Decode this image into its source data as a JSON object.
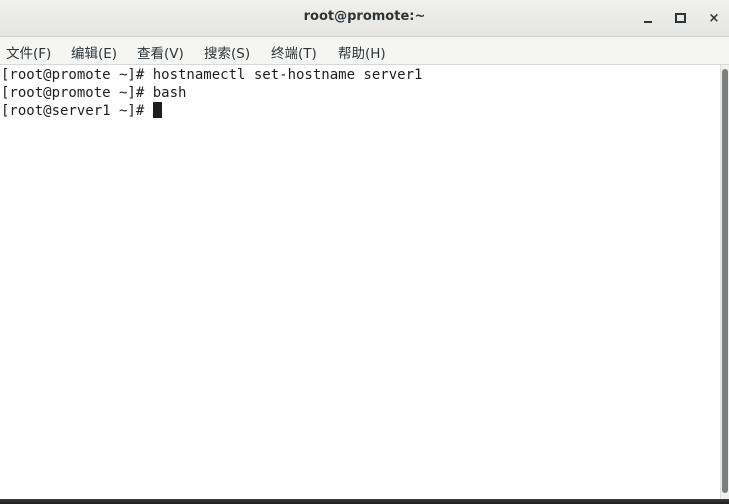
{
  "window": {
    "title": "root@promote:~",
    "controls": {
      "minimize": "minimize",
      "maximize": "maximize",
      "close": "×"
    }
  },
  "menu": [
    {
      "label": "文件(F)"
    },
    {
      "label": "编辑(E)"
    },
    {
      "label": "查看(V)"
    },
    {
      "label": "搜索(S)"
    },
    {
      "label": "终端(T)"
    },
    {
      "label": "帮助(H)"
    }
  ],
  "terminal": {
    "lines": [
      {
        "prompt": "[root@promote ~]# ",
        "command": "hostnamectl set-hostname server1"
      },
      {
        "prompt": "[root@promote ~]# ",
        "command": "bash"
      },
      {
        "prompt": "[root@server1 ~]# ",
        "command": ""
      }
    ]
  },
  "colors": {
    "background": "#ffffff",
    "text": "#1e1e1e",
    "titlebar": "#e8e8e7"
  },
  "icons": [
    "minimize-icon",
    "maximize-icon",
    "close-icon",
    "text-cursor-icon"
  ]
}
